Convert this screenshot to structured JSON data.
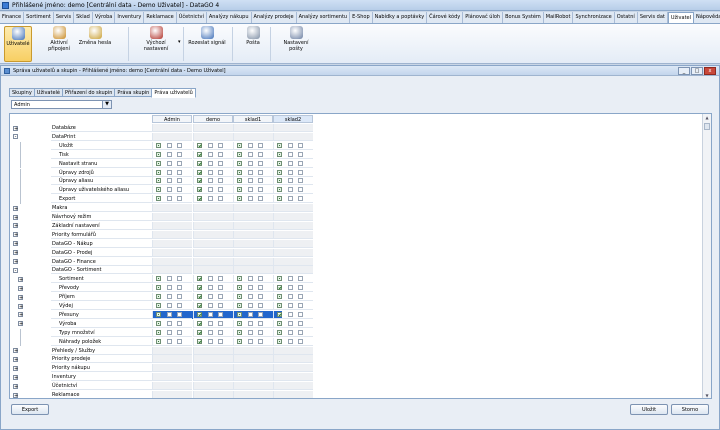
{
  "window_title": "Přihlášené jméno: demo [Centrální data - Demo Uživatel] - DataGO 4",
  "menu_tabs": [
    "Finance",
    "Sortiment",
    "Servis",
    "Sklad",
    "Výroba",
    "Inventury",
    "Reklamace",
    "Účetnictví",
    "Analýzy nákupu",
    "Analýzy prodeje",
    "Analýzy sortimentu",
    "E-Shop",
    "Nabídky a poptávky",
    "Čárové kódy",
    "Plánovač úloh",
    "Bonus Systém",
    "MailRobot",
    "Synchronizace",
    "Ostatní",
    "Servis dat",
    "Uživatel",
    "Nápověda"
  ],
  "active_menu_tab": "Uživatel",
  "ribbon": [
    {
      "label": "Uživatelé",
      "icon": "users-icon"
    },
    {
      "label": "Aktivní připojení",
      "icon": "active-connections-icon"
    },
    {
      "label": "Změna hesla",
      "icon": "change-password-icon"
    },
    {
      "label": "Výchozí nastavení",
      "icon": "default-settings-icon"
    },
    {
      "label": "Rozeslat signál",
      "icon": "broadcast-signal-icon"
    },
    {
      "label": "Pošta",
      "icon": "mail-icon"
    },
    {
      "label": "Nastavení pošty",
      "icon": "mail-settings-icon"
    }
  ],
  "inner_title": "Správa uživatelů a skupin - Přihlášené jméno: demo [Centrální data - Demo Uživatel]",
  "sub_tabs": [
    "Skupiny",
    "Uživatelé",
    "Přiřazení do skupin",
    "Práva skupin",
    "Práva uživatelů"
  ],
  "active_sub_tab": "Práva uživatelů",
  "user_combo": "Admin",
  "columns": [
    "Admin",
    "demo",
    "sklad1",
    "sklad2"
  ],
  "rows": [
    {
      "label": "Databáze",
      "level": 0,
      "exp": "+",
      "cells": null
    },
    {
      "label": "DataPrint",
      "level": 0,
      "exp": "-",
      "cells": null
    },
    {
      "label": "Uložit",
      "level": 1,
      "exp": "",
      "cells": [
        "g",
        "v",
        "g",
        "g"
      ]
    },
    {
      "label": "Tisk",
      "level": 1,
      "exp": "",
      "cells": [
        "g",
        "v",
        "g",
        "g"
      ]
    },
    {
      "label": "Nastavit stranu",
      "level": 1,
      "exp": "",
      "cells": [
        "g",
        "v",
        "g",
        "g"
      ]
    },
    {
      "label": "Úpravy zdrojů",
      "level": 1,
      "exp": "",
      "cells": [
        "g",
        "v",
        "g",
        "g"
      ]
    },
    {
      "label": "Úpravy aliasu",
      "level": 1,
      "exp": "",
      "cells": [
        "g",
        "v",
        "g",
        "g"
      ]
    },
    {
      "label": "Úpravy uživatelského aliasu",
      "level": 1,
      "exp": "",
      "cells": [
        "g",
        "v",
        "g",
        "g"
      ]
    },
    {
      "label": "Export",
      "level": 1,
      "exp": "",
      "cells": [
        "g",
        "v",
        "g",
        "g"
      ]
    },
    {
      "label": "Makra",
      "level": 0,
      "exp": "+",
      "cells": null
    },
    {
      "label": "Návrhový režim",
      "level": 0,
      "exp": "+",
      "cells": null
    },
    {
      "label": "Základní nastavení",
      "level": 0,
      "exp": "+",
      "cells": null
    },
    {
      "label": "Priority formulářů",
      "level": 0,
      "exp": "+",
      "cells": null
    },
    {
      "label": "DataGO - Nákup",
      "level": 0,
      "exp": "+",
      "cells": null
    },
    {
      "label": "DataGO - Prodej",
      "level": 0,
      "exp": "+",
      "cells": null
    },
    {
      "label": "DataGO - Finance",
      "level": 0,
      "exp": "+",
      "cells": null
    },
    {
      "label": "DataGO - Sortiment",
      "level": 0,
      "exp": "-",
      "cells": null
    },
    {
      "label": "Sortiment",
      "level": 1,
      "exp": "+",
      "cells": [
        "g",
        "v",
        "g",
        "g"
      ]
    },
    {
      "label": "Převody",
      "level": 1,
      "exp": "+",
      "cells": [
        "g",
        "v",
        "g",
        "v"
      ]
    },
    {
      "label": "Příjem",
      "level": 1,
      "exp": "+",
      "cells": [
        "g",
        "v",
        "g",
        "g"
      ]
    },
    {
      "label": "Výdej",
      "level": 1,
      "exp": "+",
      "cells": [
        "g",
        "v",
        "g",
        "g"
      ]
    },
    {
      "label": "Přesuny",
      "level": 1,
      "exp": "+",
      "cells": [
        "g",
        "v",
        "g",
        "v"
      ],
      "selected": true
    },
    {
      "label": "Výroba",
      "level": 1,
      "exp": "+",
      "cells": [
        "g",
        "v",
        "g",
        "g"
      ]
    },
    {
      "label": "Typy množství",
      "level": 1,
      "exp": "",
      "cells": [
        "g",
        "v",
        "g",
        "g"
      ]
    },
    {
      "label": "Náhrady položek",
      "level": 1,
      "exp": "",
      "cells": [
        "g",
        "v",
        "g",
        "g"
      ]
    },
    {
      "label": "Přehledy / Služby",
      "level": 0,
      "exp": "+",
      "cells": null
    },
    {
      "label": "Priority prodeje",
      "level": 0,
      "exp": "+",
      "cells": null
    },
    {
      "label": "Priority nákupu",
      "level": 0,
      "exp": "+",
      "cells": null
    },
    {
      "label": "Inventury",
      "level": 0,
      "exp": "+",
      "cells": null
    },
    {
      "label": "Účetnictví",
      "level": 0,
      "exp": "+",
      "cells": null
    },
    {
      "label": "Reklamace",
      "level": 0,
      "exp": "+",
      "cells": null
    }
  ],
  "buttons": {
    "export": "Export",
    "save": "Uložit",
    "cancel": "Storno"
  },
  "colors": {
    "accent": "#2266cc",
    "highlight": "#f8cf63"
  }
}
